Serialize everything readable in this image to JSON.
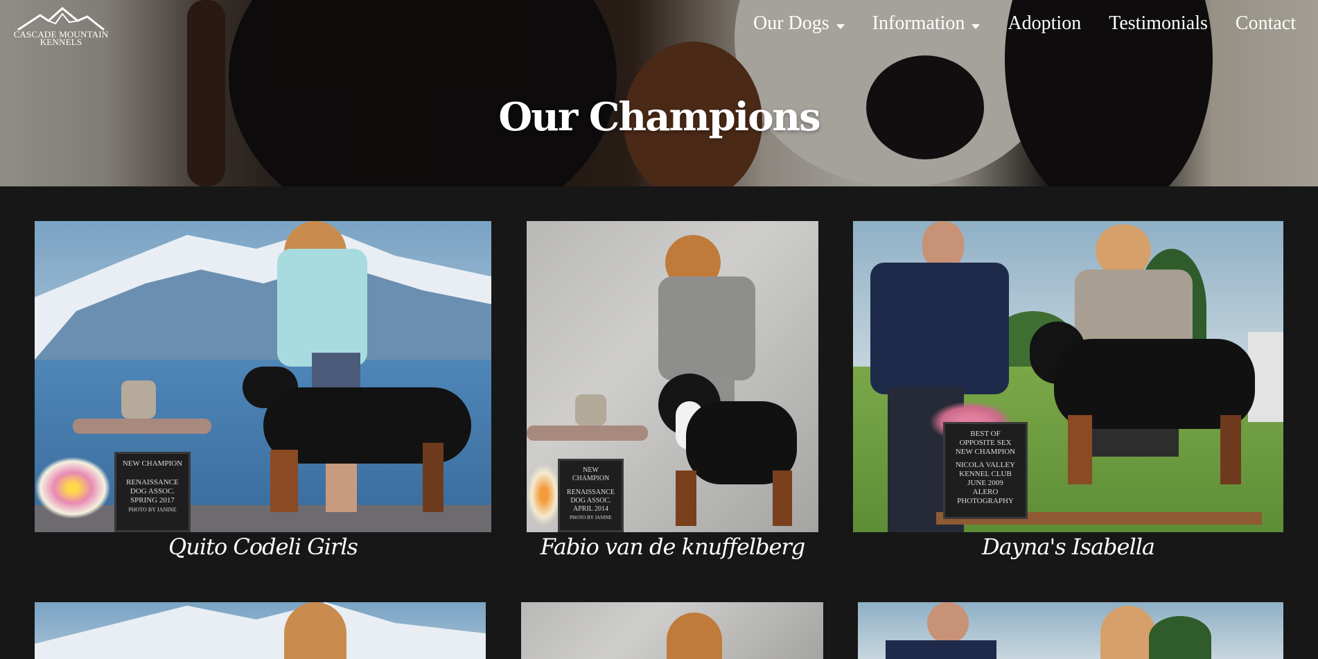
{
  "brand": {
    "name_line1": "CASCADE MOUNTAIN",
    "name_line2": "KENNELS",
    "logo_icon": "mountain-logo-icon"
  },
  "nav": {
    "items": [
      {
        "label": "Our Dogs",
        "has_dropdown": true
      },
      {
        "label": "Information",
        "has_dropdown": true
      },
      {
        "label": "Adoption",
        "has_dropdown": false
      },
      {
        "label": "Testimonials",
        "has_dropdown": false
      },
      {
        "label": "Contact",
        "has_dropdown": false
      }
    ]
  },
  "hero": {
    "title": "Our Champions"
  },
  "champions": [
    {
      "name": "Quito Codeli Girls",
      "plaque": [
        "NEW CHAMPION",
        "RENAISSANCE",
        "DOG ASSOC.",
        "SPRING 2017",
        "PHOTO BY JANINE"
      ]
    },
    {
      "name": "Fabio van de knuffelberg",
      "plaque": [
        "NEW",
        "CHAMPION",
        "RENAISSANCE",
        "DOG ASSOC.",
        "APRIL 2014",
        "PHOTO BY JANINE"
      ]
    },
    {
      "name": "Dayna's Isabella",
      "plaque": [
        "BEST OF",
        "OPPOSITE SEX",
        "NEW CHAMPION",
        "NICOLA VALLEY",
        "KENNEL CLUB",
        "JUNE 2009",
        "ALERO",
        "PHOTOGRAPHY"
      ]
    }
  ],
  "colors": {
    "page_bg": "#171717",
    "text": "#ffffff"
  }
}
